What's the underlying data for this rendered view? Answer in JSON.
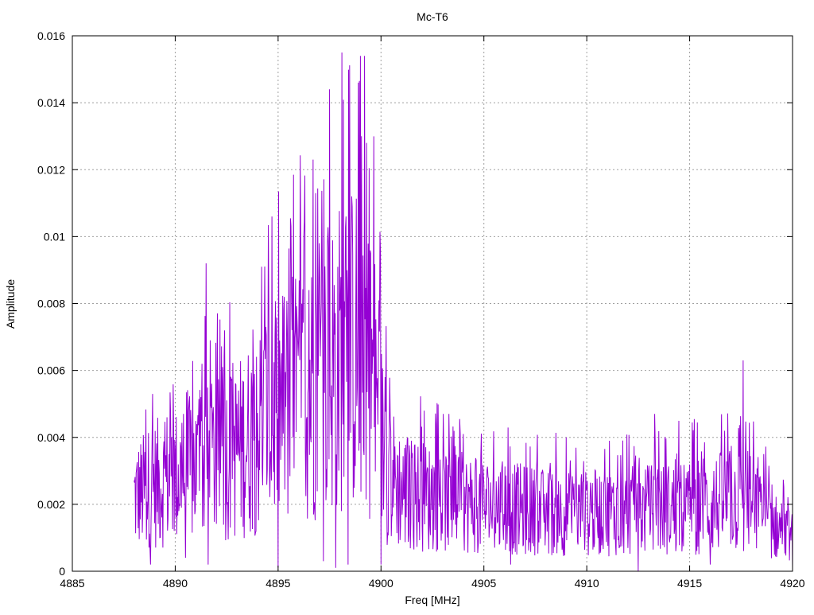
{
  "chart_data": {
    "type": "line",
    "title": "Mc-T6",
    "xlabel": "Freq [MHz]",
    "ylabel": "Amplitude",
    "xlim": [
      4885,
      4920
    ],
    "ylim": [
      0,
      0.016
    ],
    "xticks": [
      4885,
      4890,
      4895,
      4900,
      4905,
      4910,
      4915,
      4920
    ],
    "xtick_labels": [
      "4885",
      "4890",
      "4895",
      "4900",
      "4905",
      "4910",
      "4915",
      "4920"
    ],
    "yticks": [
      0,
      0.002,
      0.004,
      0.006,
      0.008,
      0.01,
      0.012,
      0.014,
      0.016
    ],
    "ytick_labels": [
      "0",
      "0.002",
      "0.004",
      "0.006",
      "0.008",
      "0.01",
      "0.012",
      "0.014",
      "0.016"
    ],
    "grid": true,
    "legend": "none",
    "line_color": "#9400d3",
    "series": [
      {
        "x_start": 4888.0,
        "x_end": 4920.0,
        "x_step": 0.025,
        "envelope": [
          [
            4888.0,
            0.0022
          ],
          [
            4889.0,
            0.0026
          ],
          [
            4890.0,
            0.0028
          ],
          [
            4891.0,
            0.0031
          ],
          [
            4892.0,
            0.0033
          ],
          [
            4893.0,
            0.0036
          ],
          [
            4894.0,
            0.0042
          ],
          [
            4895.0,
            0.0048
          ],
          [
            4896.0,
            0.0052
          ],
          [
            4897.0,
            0.0058
          ],
          [
            4898.0,
            0.0064
          ],
          [
            4899.0,
            0.0068
          ],
          [
            4899.7,
            0.0055
          ],
          [
            4900.2,
            0.0032
          ],
          [
            4901.0,
            0.0024
          ],
          [
            4903.0,
            0.0021
          ],
          [
            4906.0,
            0.0019
          ],
          [
            4909.0,
            0.0017
          ],
          [
            4912.0,
            0.0018
          ],
          [
            4915.0,
            0.0019
          ],
          [
            4917.0,
            0.0021
          ],
          [
            4918.0,
            0.002
          ],
          [
            4919.0,
            0.0014
          ],
          [
            4920.0,
            0.001
          ]
        ],
        "peaks": [
          [
            4888.9,
            0.0053
          ],
          [
            4889.6,
            0.0046
          ],
          [
            4890.4,
            0.0047
          ],
          [
            4891.3,
            0.0062
          ],
          [
            4891.5,
            0.0092
          ],
          [
            4891.7,
            0.0069
          ],
          [
            4892.3,
            0.0061
          ],
          [
            4893.0,
            0.005
          ],
          [
            4893.8,
            0.0061
          ],
          [
            4894.2,
            0.0091
          ],
          [
            4894.4,
            0.0073
          ],
          [
            4894.7,
            0.0106
          ],
          [
            4895.0,
            0.0123
          ],
          [
            4895.3,
            0.0082
          ],
          [
            4895.7,
            0.0088
          ],
          [
            4896.1,
            0.0097
          ],
          [
            4896.5,
            0.0084
          ],
          [
            4896.7,
            0.0123
          ],
          [
            4897.0,
            0.0098
          ],
          [
            4897.5,
            0.0144
          ],
          [
            4897.8,
            0.0095
          ],
          [
            4898.1,
            0.0155
          ],
          [
            4898.3,
            0.0106
          ],
          [
            4898.6,
            0.0109
          ],
          [
            4898.9,
            0.0146
          ],
          [
            4899.0,
            0.0154
          ],
          [
            4899.2,
            0.0154
          ],
          [
            4899.3,
            0.0128
          ],
          [
            4899.5,
            0.0095
          ],
          [
            4900.2,
            0.0058
          ],
          [
            4902.1,
            0.0048
          ],
          [
            4903.3,
            0.0047
          ],
          [
            4904.0,
            0.0041
          ],
          [
            4909.0,
            0.004
          ],
          [
            4911.1,
            0.0039
          ],
          [
            4913.3,
            0.0047
          ],
          [
            4916.7,
            0.0042
          ],
          [
            4917.6,
            0.0063
          ],
          [
            4918.6,
            0.0035
          ]
        ],
        "dips": [
          [
            4888.8,
            0.0002
          ],
          [
            4890.5,
            0.0004
          ],
          [
            4891.6,
            0.0002
          ],
          [
            4895.0,
            0.0001
          ],
          [
            4897.2,
            0.0003
          ],
          [
            4897.8,
            0.0001
          ],
          [
            4898.4,
            0.0002
          ],
          [
            4900.0,
            0.0002
          ],
          [
            4906.3,
            0.0002
          ],
          [
            4912.5,
            0.0
          ],
          [
            4916.0,
            0.0002
          ],
          [
            4920.0,
            0.0001
          ]
        ]
      }
    ]
  }
}
